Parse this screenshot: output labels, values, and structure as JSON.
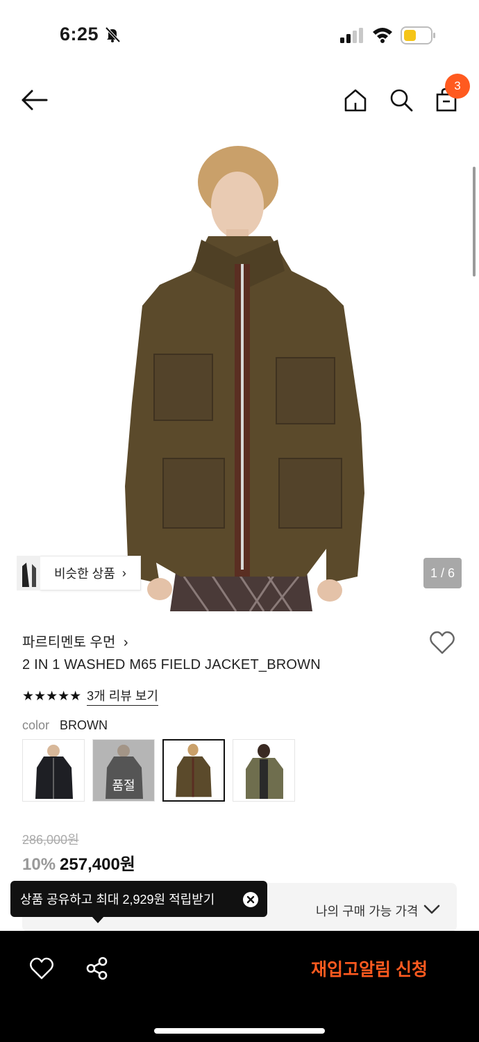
{
  "status": {
    "time": "6:25"
  },
  "cart": {
    "count": "3"
  },
  "gallery": {
    "counter": "1 / 6",
    "similar_label": "비슷한 상품"
  },
  "product": {
    "brand": "파르티멘토 우먼",
    "title": "2 IN 1 WASHED M65 FIELD JACKET_BROWN",
    "rating": 5,
    "review_link": "3개 리뷰 보기",
    "color_label": "color",
    "color_value": "BROWN",
    "swatches": [
      {
        "name": "black",
        "soldout": false,
        "selected": false
      },
      {
        "name": "charcoal",
        "soldout": true,
        "soldout_label": "품절",
        "selected": false
      },
      {
        "name": "brown",
        "soldout": false,
        "selected": true
      },
      {
        "name": "khaki",
        "soldout": false,
        "selected": false
      }
    ],
    "original_price": "286,000원",
    "discount": "10%",
    "price": "257,400원",
    "buyable_price_label": "나의 구매 가능 가격"
  },
  "tooltip": {
    "text": "상품 공유하고 최대 2,929원 적립받기"
  },
  "bottom": {
    "restock_label": "재입고알림 신청"
  },
  "colors": {
    "accent": "#ff5a1f",
    "jacket": "#5a4a2a"
  },
  "icons": [
    "back-arrow-icon",
    "home-icon",
    "search-icon",
    "bag-icon",
    "heart-icon",
    "share-icon",
    "close-icon",
    "chevron-down-icon",
    "bell-off-icon"
  ]
}
